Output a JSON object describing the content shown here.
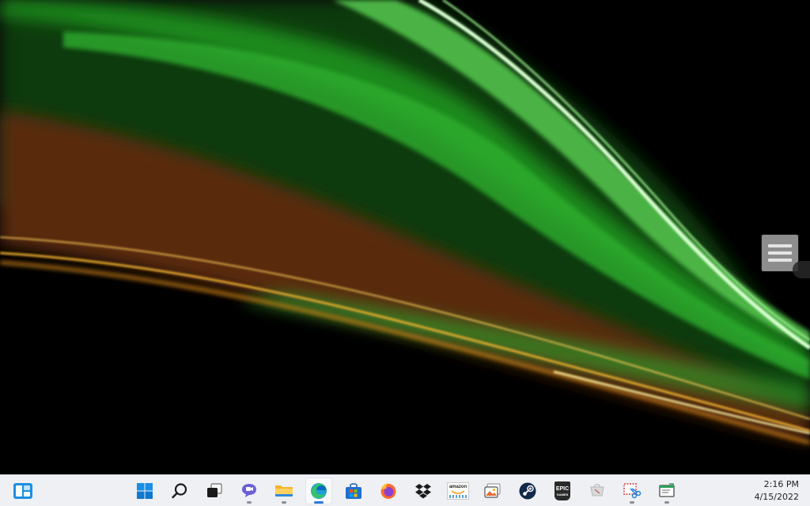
{
  "desktop": {
    "wallpaper": "green and amber light streaks on black",
    "side_widget_icon": "menu-icon"
  },
  "taskbar": {
    "background": "#eef0f4",
    "widgets_icon": "widgets-icon",
    "items": [
      {
        "name": "start",
        "icon": "windows-start-icon"
      },
      {
        "name": "search",
        "icon": "search-icon"
      },
      {
        "name": "task-view",
        "icon": "task-view-icon"
      },
      {
        "name": "chat",
        "icon": "teams-chat-icon",
        "open": true
      },
      {
        "name": "file-explorer",
        "icon": "folder-icon",
        "open": true
      },
      {
        "name": "edge",
        "icon": "edge-icon",
        "open": true,
        "active": true
      },
      {
        "name": "microsoft-store",
        "icon": "store-icon"
      },
      {
        "name": "firefox",
        "icon": "firefox-icon"
      },
      {
        "name": "dropbox",
        "icon": "dropbox-icon"
      },
      {
        "name": "amazon",
        "icon": "amazon-icon"
      },
      {
        "name": "photos",
        "icon": "photos-icon"
      },
      {
        "name": "steam",
        "icon": "steam-icon"
      },
      {
        "name": "epic-games",
        "icon": "epic-games-icon"
      },
      {
        "name": "app-gray",
        "icon": "app-icon"
      },
      {
        "name": "snipping-tool",
        "icon": "snipping-tool-icon",
        "open": true
      },
      {
        "name": "app-window",
        "icon": "app-window-icon",
        "open": true
      }
    ],
    "amazon_label": "amazon",
    "epic_label": "EPIC",
    "epic_sub": "GAMES",
    "time": "2:16 PM",
    "date": "4/15/2022"
  }
}
